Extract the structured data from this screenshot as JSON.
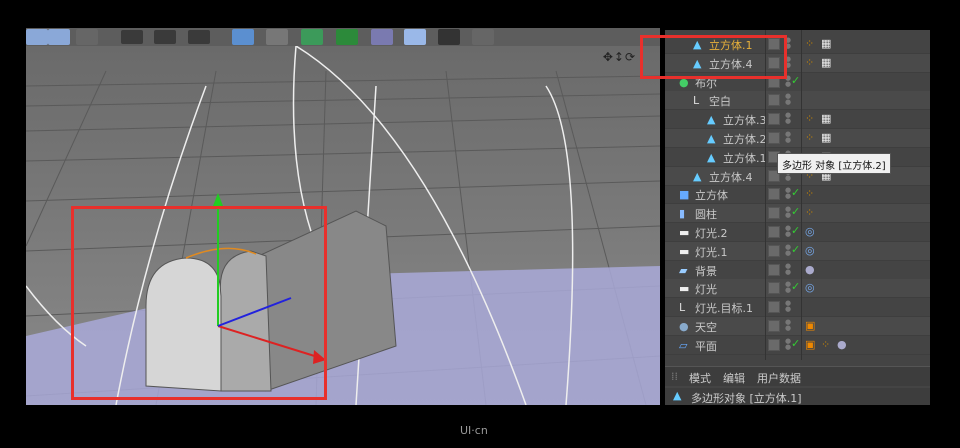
{
  "object_manager": {
    "rows": [
      {
        "label": "立方体.1",
        "level": 1,
        "icon": "polygon-icon",
        "selected": true,
        "tags": [
          "phong",
          "checker"
        ]
      },
      {
        "label": "立方体.4",
        "level": 1,
        "icon": "polygon-icon",
        "tags": [
          "phong",
          "checker"
        ]
      },
      {
        "label": "布尔",
        "level": 0,
        "icon": "boole-icon",
        "check": true,
        "tags": []
      },
      {
        "label": "空白",
        "level": 1,
        "icon": "null-icon",
        "tags": []
      },
      {
        "label": "立方体.3",
        "level": 2,
        "icon": "polygon-icon",
        "tags": [
          "phong",
          "checker"
        ]
      },
      {
        "label": "立方体.2",
        "level": 2,
        "icon": "polygon-icon",
        "tags": [
          "phong",
          "checker"
        ]
      },
      {
        "label": "立方体.1",
        "level": 2,
        "icon": "polygon-icon",
        "tags": [
          "phong",
          "checker"
        ]
      },
      {
        "label": "立方体.4",
        "level": 1,
        "icon": "polygon-icon",
        "tags": [
          "phong",
          "checker"
        ]
      },
      {
        "label": "立方体",
        "level": 0,
        "icon": "cube-icon",
        "check": true,
        "tags": [
          "phong"
        ]
      },
      {
        "label": "圆柱",
        "level": 0,
        "icon": "cylinder-icon",
        "check": true,
        "tags": [
          "phong"
        ]
      },
      {
        "label": "灯光.2",
        "level": 0,
        "icon": "light-icon",
        "check": true,
        "tags": [
          "target"
        ]
      },
      {
        "label": "灯光.1",
        "level": 0,
        "icon": "light-icon",
        "check": true,
        "tags": [
          "target"
        ]
      },
      {
        "label": "背景",
        "level": 0,
        "icon": "background-icon",
        "tags": [
          "material"
        ]
      },
      {
        "label": "灯光",
        "level": 0,
        "icon": "light-icon",
        "check": true,
        "tags": [
          "target"
        ]
      },
      {
        "label": "灯光.目标.1",
        "level": 0,
        "icon": "null-icon",
        "tags": []
      },
      {
        "label": "天空",
        "level": 0,
        "icon": "sky-icon",
        "tags": [
          "compositing"
        ]
      },
      {
        "label": "平面",
        "level": 0,
        "icon": "plane-icon",
        "check": true,
        "tags": [
          "compositing",
          "phong",
          "material"
        ]
      }
    ],
    "tooltip": "多边形 对象 [立方体.2]"
  },
  "attributes": {
    "tabs": [
      "模式",
      "编辑",
      "用户数据"
    ],
    "title": "多边形对象 [立方体.1]"
  },
  "watermark": "UI·cn",
  "colors": {
    "highlight": "#e8302c",
    "selected_text": "#e8b13a"
  }
}
